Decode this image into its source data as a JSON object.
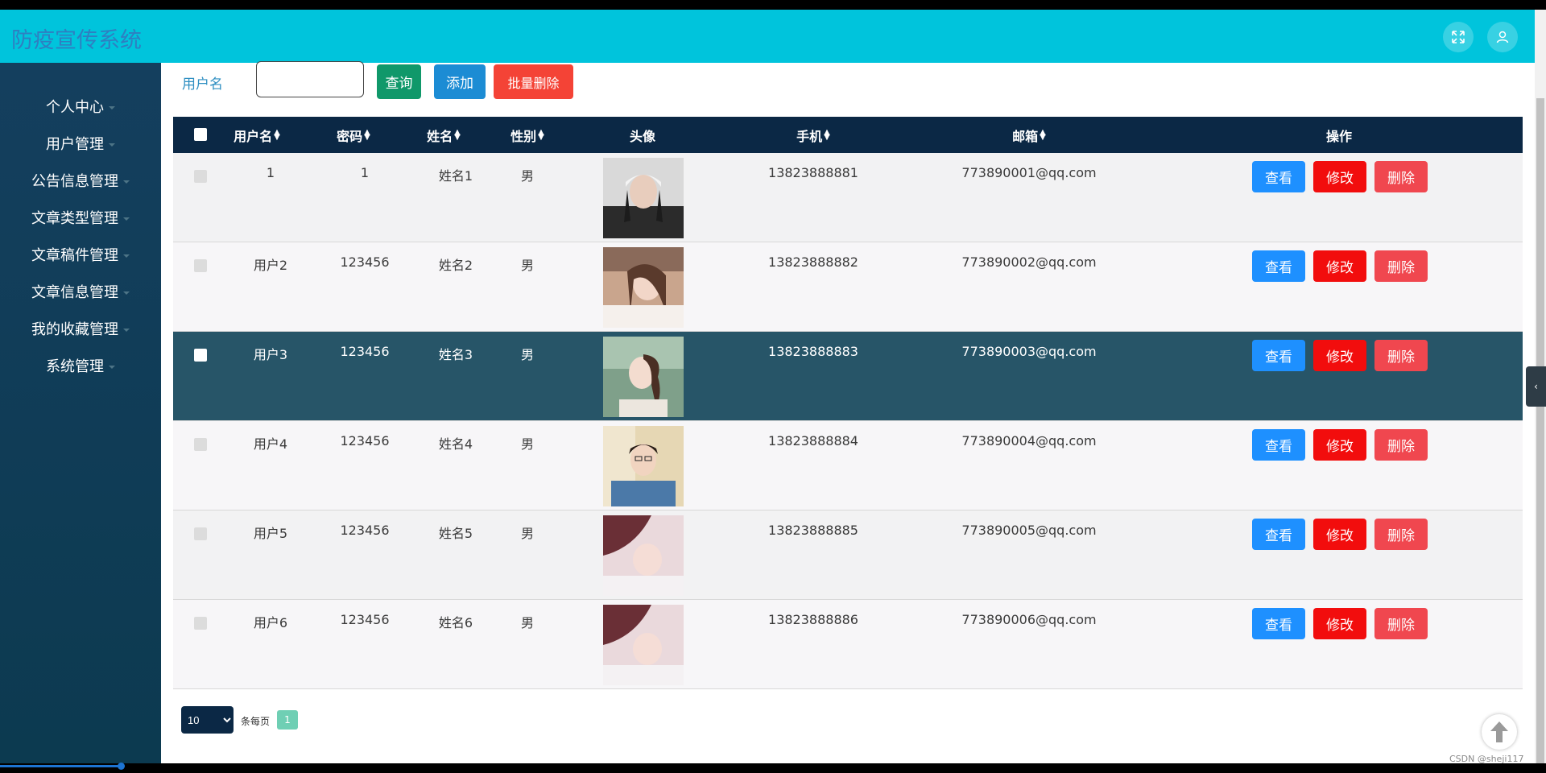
{
  "app": {
    "title": "防疫宣传系统"
  },
  "header": {
    "fullscreen_icon": "expand-icon",
    "user_icon": "user-icon"
  },
  "sidebar": {
    "items": [
      {
        "label": "个人中心"
      },
      {
        "label": "用户管理"
      },
      {
        "label": "公告信息管理"
      },
      {
        "label": "文章类型管理"
      },
      {
        "label": "文章稿件管理"
      },
      {
        "label": "文章信息管理"
      },
      {
        "label": "我的收藏管理"
      },
      {
        "label": "系统管理"
      }
    ]
  },
  "search": {
    "label": "用户名",
    "value": "",
    "query_label": "查询",
    "add_label": "添加",
    "batch_delete_label": "批量删除"
  },
  "table": {
    "headers": {
      "username": "用户名",
      "password": "密码",
      "name": "姓名",
      "gender": "性别",
      "avatar": "头像",
      "phone": "手机",
      "email": "邮箱",
      "actions": "操作"
    },
    "rows": [
      {
        "username": "1",
        "password": "1",
        "name": "姓名1",
        "gender": "男",
        "phone": "13823888881",
        "email": "773890001@qq.com"
      },
      {
        "username": "用户2",
        "password": "123456",
        "name": "姓名2",
        "gender": "男",
        "phone": "13823888882",
        "email": "773890002@qq.com"
      },
      {
        "username": "用户3",
        "password": "123456",
        "name": "姓名3",
        "gender": "男",
        "phone": "13823888883",
        "email": "773890003@qq.com"
      },
      {
        "username": "用户4",
        "password": "123456",
        "name": "姓名4",
        "gender": "男",
        "phone": "13823888884",
        "email": "773890004@qq.com"
      },
      {
        "username": "用户5",
        "password": "123456",
        "name": "姓名5",
        "gender": "男",
        "phone": "13823888885",
        "email": "773890005@qq.com"
      },
      {
        "username": "用户6",
        "password": "123456",
        "name": "姓名6",
        "gender": "男",
        "phone": "13823888886",
        "email": "773890006@qq.com"
      }
    ],
    "action_labels": {
      "view": "查看",
      "edit": "修改",
      "delete": "删除"
    }
  },
  "pagination": {
    "page_size": "10",
    "per_page_text": "条每页",
    "current_page": "1"
  },
  "watermark": "CSDN @sheji117",
  "colors": {
    "topbar": "#00c4dc",
    "sidebar": "#143f5e",
    "table_header": "#0b2845",
    "highlight_row": "#275568",
    "view_button": "#1e90ff",
    "edit_button": "#f20d0d",
    "delete_button": "#f0474f"
  }
}
